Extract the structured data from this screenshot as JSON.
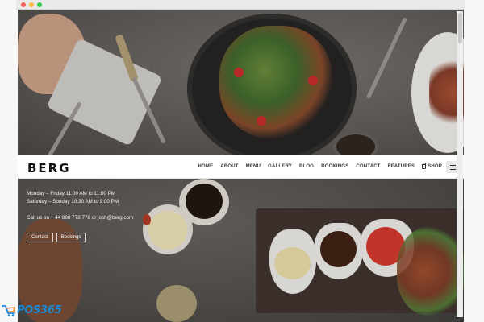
{
  "browser": {
    "dots": [
      "#fc605c",
      "#fdbc40",
      "#34c84a"
    ]
  },
  "navbar": {
    "logo": "BERG",
    "items": [
      {
        "label": "HOME"
      },
      {
        "label": "ABOUT"
      },
      {
        "label": "MENU"
      },
      {
        "label": "GALLERY"
      },
      {
        "label": "BLOG"
      },
      {
        "label": "BOOKINGS"
      },
      {
        "label": "CONTACT"
      },
      {
        "label": "FEATURES"
      },
      {
        "label": "SHOP",
        "icon": "shopping-bag-icon"
      }
    ],
    "menu_icon": "hamburger-icon"
  },
  "info": {
    "hours_weekday": "Monday – Friday 11:00 AM to 11:00 PM",
    "hours_weekend": "Saturday – Sunday 10:30 AM to 9:00 PM",
    "contact_line": "Call us on + 44 888 778 778 or josh@berg.com",
    "buttons": {
      "contact": "Contact",
      "bookings": "Bookings"
    }
  },
  "watermark": {
    "text": "POS365",
    "color": "#1d86d1"
  }
}
